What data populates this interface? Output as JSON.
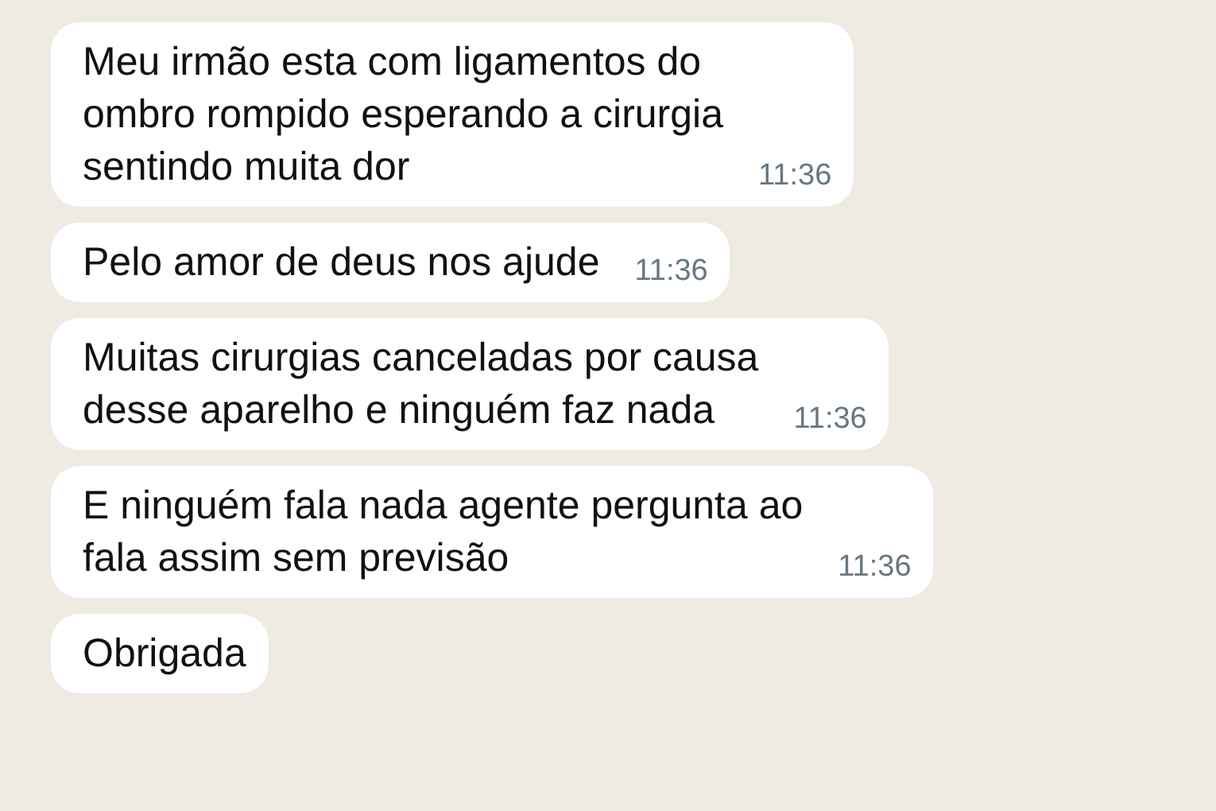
{
  "messages": [
    {
      "text": "Meu irmão esta com ligamentos do\nombro rompido esperando a cirurgia\nsentindo muita dor",
      "time": "11:36"
    },
    {
      "text": "Pelo amor de deus nos ajude",
      "time": "11:36"
    },
    {
      "text": "Muitas cirurgias canceladas por causa\ndesse aparelho e ninguém faz nada",
      "time": "11:36"
    },
    {
      "text": "E ninguém fala nada agente pergunta ao\nfala assim sem previsão",
      "time": "11:36"
    },
    {
      "text": "Obrigada"
    }
  ]
}
